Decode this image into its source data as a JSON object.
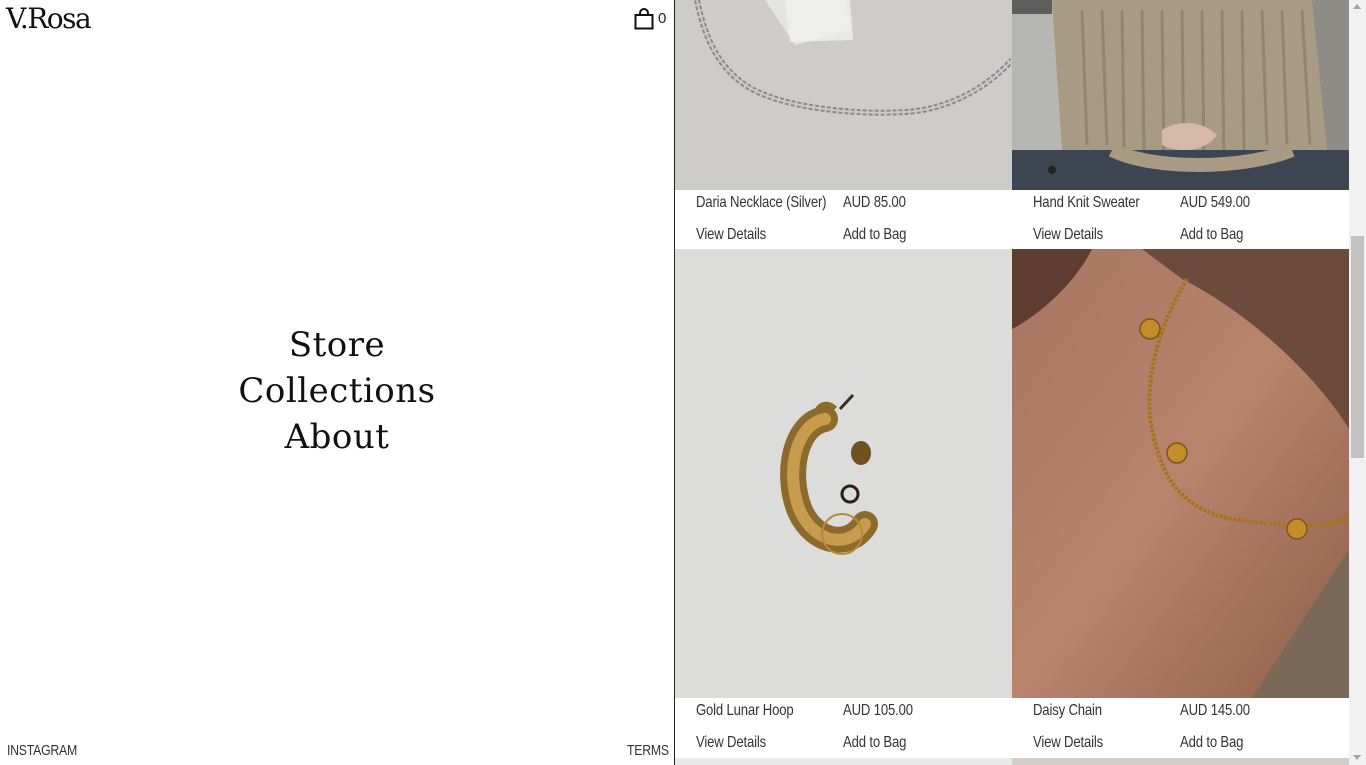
{
  "brand": "V.Rosa",
  "bag_count": "0",
  "menu": [
    "Store",
    "Collections",
    "About"
  ],
  "footer": {
    "instagram": "INSTAGRAM",
    "terms": "TERMS"
  },
  "products": [
    {
      "name": "Daria Necklace (Silver)",
      "price": "AUD 85.00",
      "details": "View Details",
      "add": "Add to Bag",
      "image_icon": "silver-chain-necklace"
    },
    {
      "name": "Hand Knit Sweater",
      "price": "AUD 549.00",
      "details": "View Details",
      "add": "Add to Bag",
      "image_icon": "knit-sweater"
    },
    {
      "name": "Gold Lunar Hoop",
      "price": "AUD 105.00",
      "details": "View Details",
      "add": "Add to Bag",
      "image_icon": "gold-hoop-earring"
    },
    {
      "name": "Daisy Chain",
      "price": "AUD 145.00",
      "details": "View Details",
      "add": "Add to Bag",
      "image_icon": "gold-daisy-chain"
    }
  ]
}
